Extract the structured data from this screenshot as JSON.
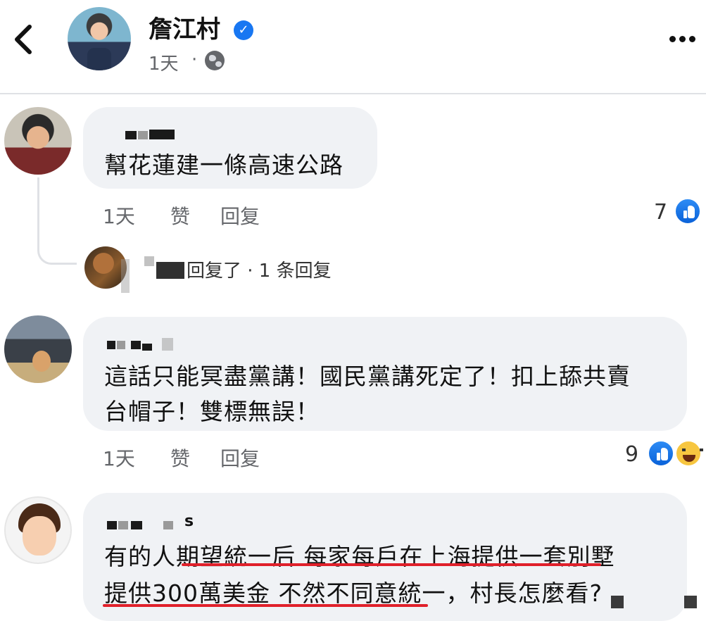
{
  "header": {
    "page_name": "詹江村",
    "post_time": "1天",
    "separator": "·",
    "icons": {
      "back": "chevron-left-icon",
      "verified": "verified-badge-icon",
      "audience": "globe-icon",
      "more": "more-dots-icon"
    }
  },
  "comments": [
    {
      "text_lines": [
        "幫花蓮建一條高速公路"
      ],
      "time": "1天",
      "like_label": "赞",
      "reply_label": "回复",
      "reaction_count": "7",
      "reactions": [
        "like-icon"
      ],
      "replies_summary": "回复了 · 1 条回复"
    },
    {
      "text_lines": [
        "這話只能冥盡黨講！國民黨講死定了！扣上舔共賣",
        "台帽子！雙標無誤！"
      ],
      "time": "1天",
      "like_label": "赞",
      "reply_label": "回复",
      "reaction_count": "9",
      "reactions": [
        "like-icon",
        "haha-icon"
      ]
    },
    {
      "author_suffix": "s",
      "text_lines": [
        "有的人期望統一后 每家每戶在上海提供一套別墅",
        "提供300萬美金 不然不同意統一，村長怎麼看?"
      ]
    }
  ],
  "colors": {
    "accent": "#1877f2",
    "bubble": "#f0f2f5",
    "meta_text": "#65676b",
    "highlight": "#e0202a"
  }
}
